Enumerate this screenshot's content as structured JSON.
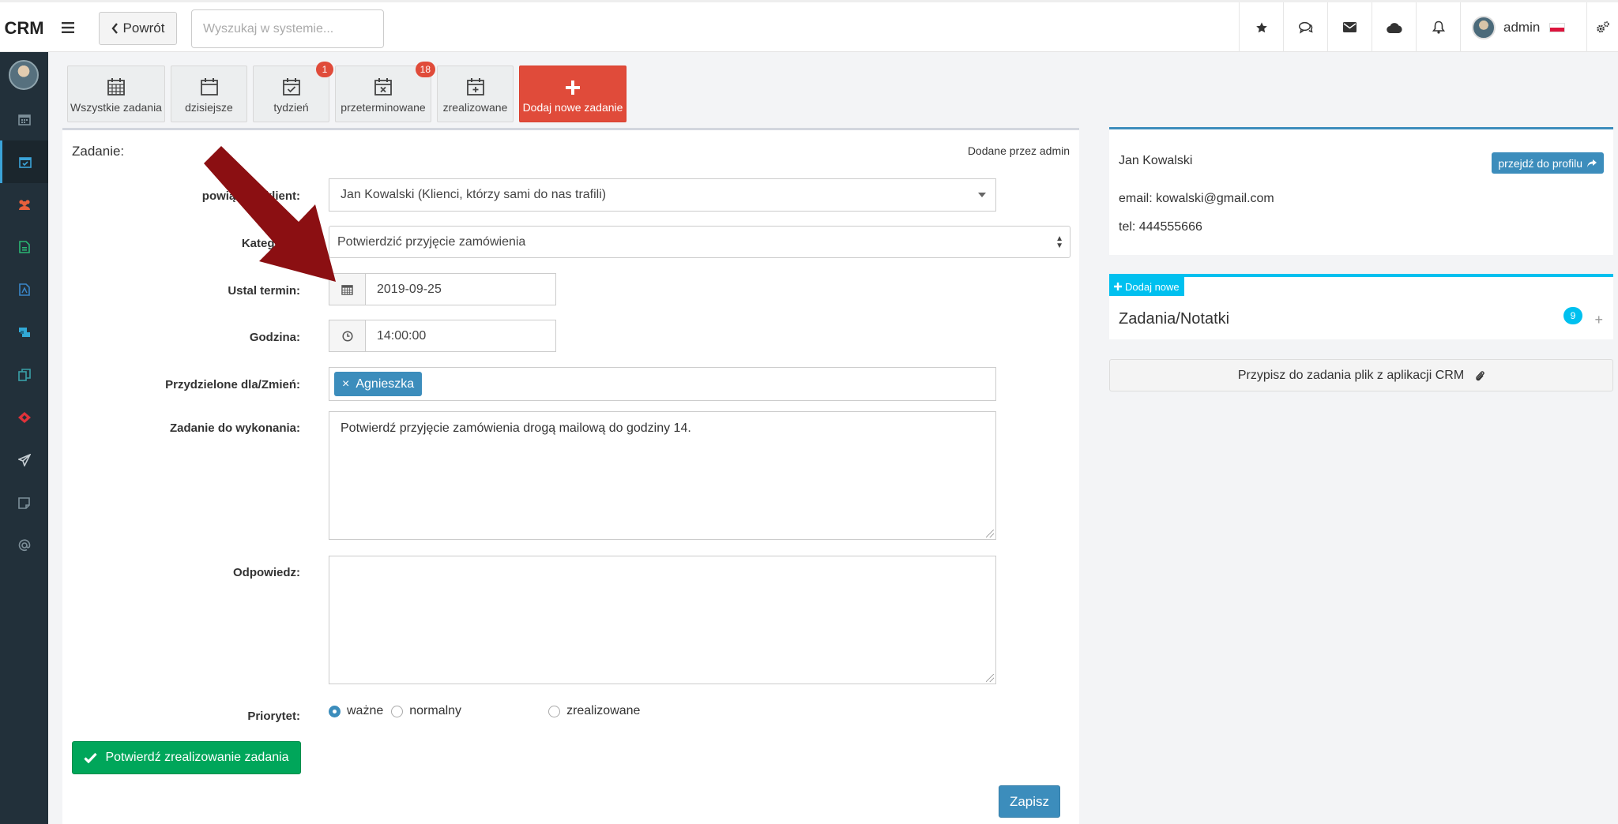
{
  "app": {
    "logo": "CRM"
  },
  "topbar": {
    "back_label": "Powrót",
    "search_placeholder": "Wyszukaj w systemie...",
    "user_name": "admin",
    "icons": [
      "star-icon",
      "chat-icon",
      "envelope-icon",
      "cloud-icon",
      "bell-icon",
      "gears-icon"
    ]
  },
  "sidebar": {
    "icons": [
      "calendar-icon",
      "tasks-icon",
      "users-icon",
      "document-icon",
      "pdf-icon",
      "handshake-icon",
      "copy-icon",
      "ticket-icon",
      "send-icon",
      "note-icon",
      "at-icon"
    ],
    "active": "tasks-icon"
  },
  "task_tabs": [
    {
      "label": "Wszystkie zadania",
      "icon": "calendar-icon",
      "badge": ""
    },
    {
      "label": "dzisiejsze",
      "icon": "calendar-blank-icon",
      "badge": ""
    },
    {
      "label": "tydzień",
      "icon": "calendar-check-icon",
      "badge": "1"
    },
    {
      "label": "przeterminowane",
      "icon": "calendar-times-icon",
      "badge": "18"
    },
    {
      "label": "zrealizowane",
      "icon": "calendar-plus-icon",
      "badge": ""
    },
    {
      "label": "Dodaj nowe zadanie",
      "icon": "plus-icon",
      "badge": ""
    }
  ],
  "form": {
    "title": "Zadanie:",
    "added_by": "Dodane przez admin",
    "client_label": "powiązany klient:",
    "client_value": "Jan Kowalski (Klienci, którzy sami do nas trafili)",
    "category_label": "Kategoria:",
    "category_value": "Potwierdzić przyjęcie zamówienia",
    "date_label": "Ustal termin:",
    "date_value": "2019-09-25",
    "time_label": "Godzina:",
    "time_value": "14:00:00",
    "assigned_label": "Przydzielone dla/Zmień:",
    "assigned_tag": "Agnieszka",
    "task_label": "Zadanie do wykonania:",
    "task_value": "Potwierdź przyjęcie zamówienia drogą mailową do godziny 14.",
    "reply_label": "Odpowiedz:",
    "reply_value": "",
    "priority_label": "Priorytet:",
    "priority_options": [
      "ważne",
      "normalny",
      "zrealizowane"
    ],
    "priority_selected": "ważne",
    "confirm_button": "Potwierdź zrealizowanie zadania",
    "save_button": "Zapisz"
  },
  "client_card": {
    "name": "Jan Kowalski",
    "profile_button": "przejdź do profilu",
    "email": "email: kowalski@gmail.com",
    "tel": "tel: 444555666"
  },
  "notes_card": {
    "add_button": "Dodaj nowe",
    "title": "Zadania/Notatki",
    "count": "9"
  },
  "attach_bar": {
    "label": "Przypisz do zadania plik z aplikacji CRM"
  },
  "colors": {
    "sidebar": "#22303a",
    "primary": "#3c8dbc",
    "danger": "#e04b3a",
    "success": "#00a65a",
    "info": "#00c0ef",
    "arrow": "#8b0f12"
  }
}
